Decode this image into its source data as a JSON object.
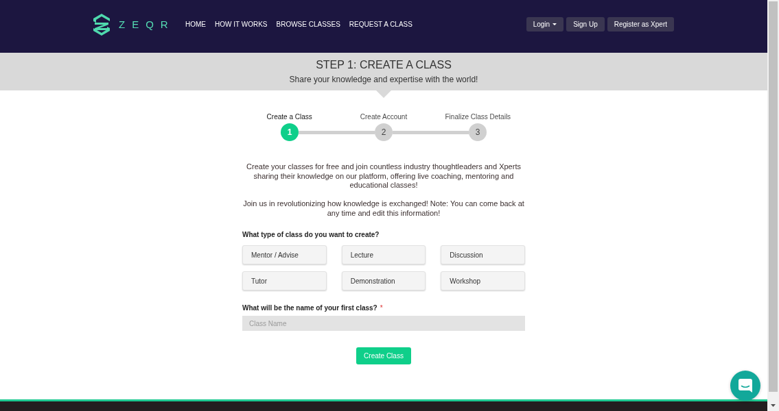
{
  "header": {
    "logo": "ZEQR",
    "nav": [
      "HOME",
      "HOW IT WORKS",
      "BROWSE CLASSES",
      "REQUEST A CLASS"
    ],
    "actions": [
      {
        "label": "Login",
        "kind": "dropdown"
      },
      {
        "label": "Sign Up",
        "kind": "button"
      },
      {
        "label": "Register as Xpert",
        "kind": "button"
      }
    ]
  },
  "banner": {
    "title": "STEP 1: CREATE A CLASS",
    "subtitle": "Share your knowledge and expertise with the world!"
  },
  "steps": [
    {
      "label": "Create a Class",
      "number": "1",
      "selected": true
    },
    {
      "label": "Create Account",
      "number": "2",
      "selected": false
    },
    {
      "label": "Finalize Class Details",
      "number": "3",
      "selected": false
    }
  ],
  "intro": [
    "Create your classes for free and join countless industry thoughtleaders and Xperts sharing their knowledge on our platform, offering live coaching, mentoring and educational classes!",
    "Join us in revolutionizing how knowledge is exchanged! Note: You can come back at any time and edit this information!"
  ],
  "class_type": {
    "question": "What type of class do you want to create?",
    "options": [
      {
        "label": "Mentor / Advise",
        "selected": false
      },
      {
        "label": "Lecture",
        "selected": false
      },
      {
        "label": "Discussion",
        "selected": false
      },
      {
        "label": "Tutor",
        "selected": false
      },
      {
        "label": "Demonstration",
        "selected": false
      },
      {
        "label": "Workshop",
        "selected": false
      }
    ]
  },
  "class_name": {
    "question": "What will be the name of your first class?",
    "required_mark": "*",
    "placeholder": "Class Name"
  },
  "submit": {
    "label": "Create Class"
  }
}
